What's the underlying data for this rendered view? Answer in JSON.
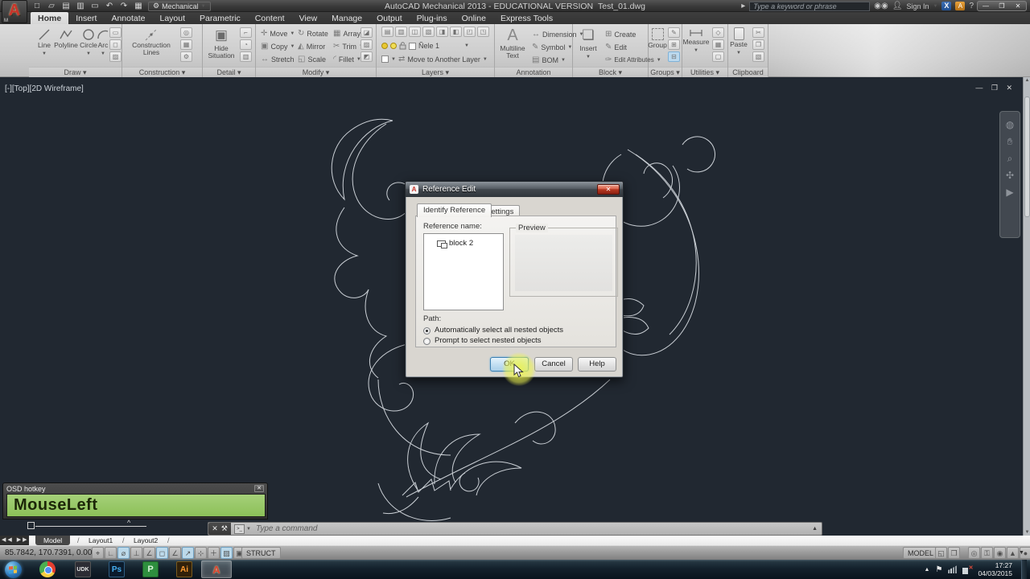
{
  "window": {
    "app_title": "AutoCAD Mechanical 2013 - EDUCATIONAL VERSION",
    "doc_name": "Test_01.dwg",
    "workspace": "Mechanical",
    "app_badge": "M",
    "search_placeholder": "Type a keyword or phrase",
    "sign_in_label": "Sign In"
  },
  "ribbon": {
    "tabs": [
      {
        "label": "Home"
      },
      {
        "label": "Insert"
      },
      {
        "label": "Annotate"
      },
      {
        "label": "Layout"
      },
      {
        "label": "Parametric"
      },
      {
        "label": "Content"
      },
      {
        "label": "View"
      },
      {
        "label": "Manage"
      },
      {
        "label": "Output"
      },
      {
        "label": "Plug-ins"
      },
      {
        "label": "Online"
      },
      {
        "label": "Express Tools"
      }
    ],
    "panel_labels": {
      "draw": "Draw",
      "construction": "Construction",
      "detail": "Detail",
      "modify": "Modify",
      "layers": "Layers",
      "annotation": "Annotation",
      "block": "Block",
      "groups": "Groups",
      "utilities": "Utilities",
      "clipboard": "Clipboard"
    },
    "draw": {
      "line": "Line",
      "polyline": "Polyline",
      "circle": "Circle",
      "arc": "Arc"
    },
    "construction": {
      "lines": "Construction Lines"
    },
    "detail": {
      "hide": "Hide Situation"
    },
    "modify": {
      "move": "Move",
      "rotate": "Rotate",
      "array": "Array",
      "copy": "Copy",
      "mirror": "Mirror",
      "trim": "Trim",
      "stretch": "Stretch",
      "scale": "Scale",
      "fillet": "Fillet"
    },
    "layers": {
      "layer_name": "Ñele 1",
      "move_to": "Move to Another Layer"
    },
    "annotation": {
      "multiline": "Multiline Text",
      "dimension": "Dimension",
      "symbol": "Symbol",
      "bom": "BOM"
    },
    "block": {
      "insert": "Insert",
      "create": "Create",
      "edit": "Edit",
      "edit_attrs": "Edit Attributes"
    },
    "groups": {
      "group": "Group"
    },
    "utilities": {
      "measure": "Measure"
    },
    "clipboard": {
      "paste": "Paste"
    }
  },
  "viewport": {
    "label": "[-][Top][2D Wireframe]"
  },
  "dialog": {
    "title": "Reference Edit",
    "tab_identify": "Identify Reference",
    "tab_settings": "Settings",
    "reference_label": "Reference name:",
    "reference_item": "block 2",
    "preview_label": "Preview",
    "path_label": "Path:",
    "radio_auto": "Automatically select all nested objects",
    "radio_prompt": "Prompt to select nested objects",
    "ok": "OK",
    "cancel": "Cancel",
    "help": "Help"
  },
  "osd": {
    "title": "OSD hotkey",
    "hotkey": "MouseLeft",
    "green_color": "#8cc058"
  },
  "command": {
    "prompt_placeholder": "Type a command"
  },
  "sheet_tabs": {
    "model": "Model",
    "layout1": "Layout1",
    "layout2": "Layout2"
  },
  "status": {
    "coords": "85.7842, 170.7391, 0.0000",
    "struct_label": "STRUCT",
    "model_label": "MODEL"
  },
  "taskbar": {
    "time": "17:27",
    "date": "04/03/2015",
    "udk": "UDK",
    "ps": "Ps",
    "ai": "Ai"
  }
}
